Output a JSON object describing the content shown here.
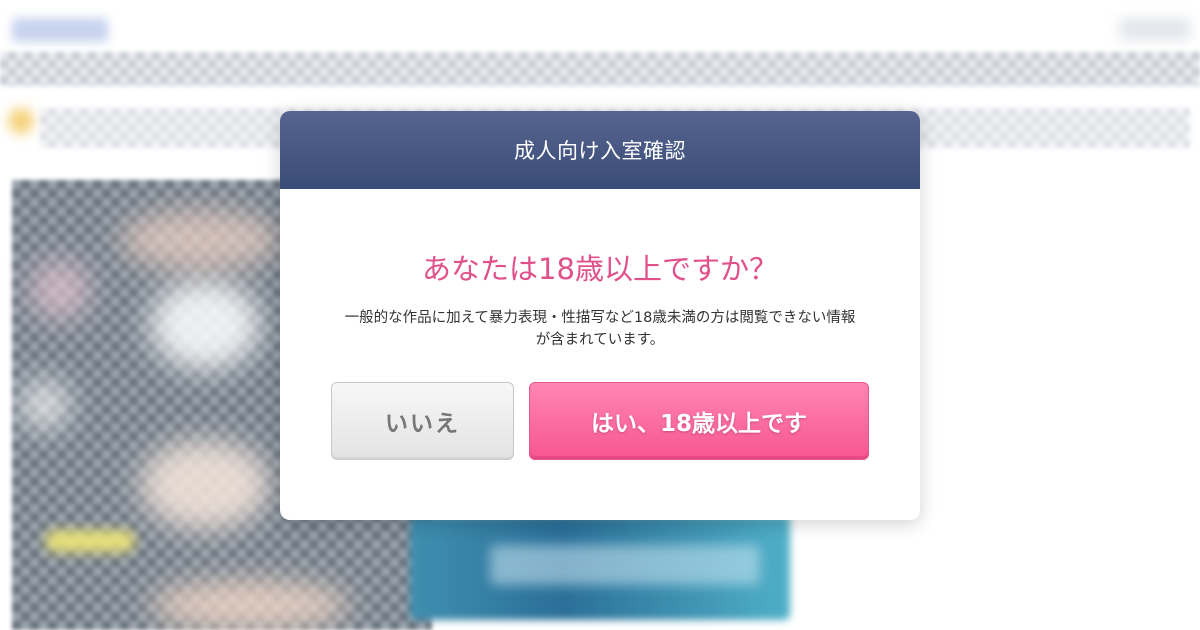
{
  "modal": {
    "title": "成人向け入室確認",
    "question": "あなたは18歳以上ですか？",
    "description_line1": "一般的な作品に加えて暴力表現・性描写など18歳未満の方は閲覧できない情報",
    "description_line2": "が含まれています。",
    "no_button": "いいえ",
    "yes_button": "はい、18歳以上です"
  },
  "colors": {
    "header": "#3f5080",
    "question": "#e0508a",
    "yes_button": "#f7568f",
    "no_button": "#e8e8e8"
  }
}
